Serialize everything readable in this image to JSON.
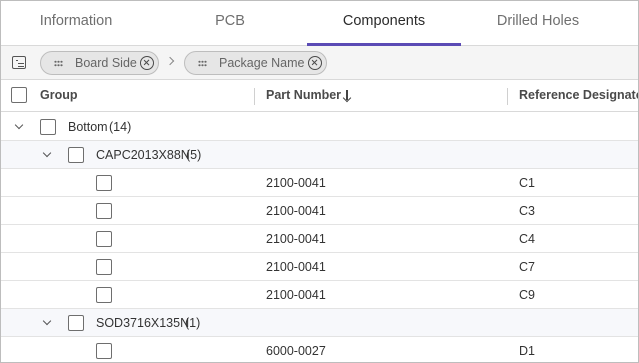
{
  "tabs": [
    {
      "label": "Information"
    },
    {
      "label": "PCB"
    },
    {
      "label": "Components"
    },
    {
      "label": "Drilled Holes"
    }
  ],
  "active_tab": "Components",
  "grouping": {
    "chips": [
      {
        "label": "Board Side"
      },
      {
        "label": "Package Name"
      }
    ]
  },
  "columns": {
    "group": "Group",
    "part_number": "Part Number",
    "reference_designator": "Reference Designator"
  },
  "sort": {
    "column": "part_number",
    "direction": "descending"
  },
  "rows": [
    {
      "type": "group",
      "level": 1,
      "label": "Bottom",
      "count": "(14)"
    },
    {
      "type": "group",
      "level": 2,
      "label": "CAPC2013X88N",
      "count": "(5)"
    },
    {
      "type": "data",
      "part_number": "2100-0041",
      "ref": "C1"
    },
    {
      "type": "data",
      "part_number": "2100-0041",
      "ref": "C3"
    },
    {
      "type": "data",
      "part_number": "2100-0041",
      "ref": "C4"
    },
    {
      "type": "data",
      "part_number": "2100-0041",
      "ref": "C7"
    },
    {
      "type": "data",
      "part_number": "2100-0041",
      "ref": "C9"
    },
    {
      "type": "group",
      "level": 2,
      "label": "SOD3716X135N",
      "count": "(1)"
    },
    {
      "type": "data",
      "part_number": "6000-0027",
      "ref": "D1"
    }
  ],
  "colors": {
    "accent": "#5b4bb5"
  }
}
